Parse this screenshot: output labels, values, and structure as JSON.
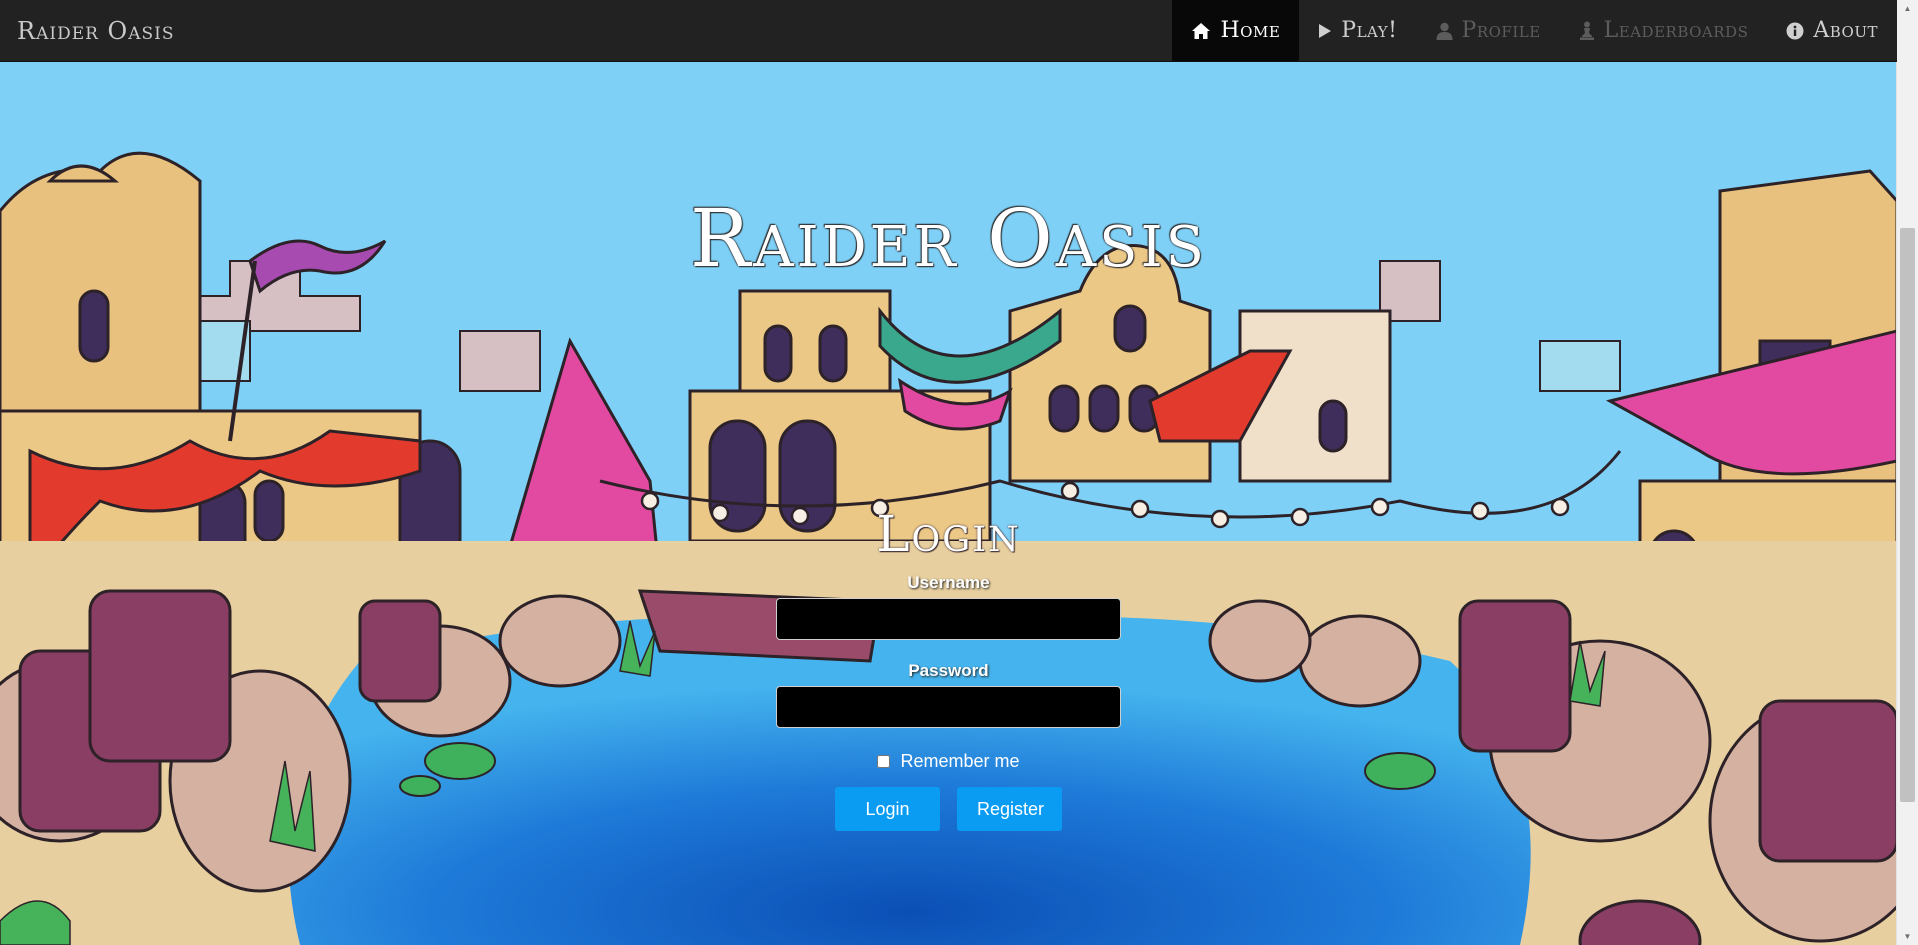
{
  "navbar": {
    "brand": "Raider Oasis",
    "items": [
      {
        "label": "Home",
        "icon": "home-icon",
        "state": "active"
      },
      {
        "label": "Play!",
        "icon": "play-icon",
        "state": "enabled"
      },
      {
        "label": "Profile",
        "icon": "user-icon",
        "state": "disabled"
      },
      {
        "label": "Leaderboards",
        "icon": "pawn-icon",
        "state": "disabled"
      },
      {
        "label": "About",
        "icon": "info-icon",
        "state": "enabled"
      }
    ]
  },
  "hero": {
    "title": "Raider Oasis",
    "background": "illustrated-desert-oasis-market"
  },
  "login": {
    "heading": "Login",
    "username_label": "Username",
    "username_value": "",
    "password_label": "Password",
    "password_value": "",
    "remember_label": "Remember me",
    "remember_checked": false,
    "login_button": "Login",
    "register_button": "Register"
  },
  "colors": {
    "navbar_bg": "#222222",
    "nav_active_bg": "#080808",
    "sky": "#7fd0f7",
    "water": "#1f78d6",
    "button": "#0a9cf3"
  }
}
